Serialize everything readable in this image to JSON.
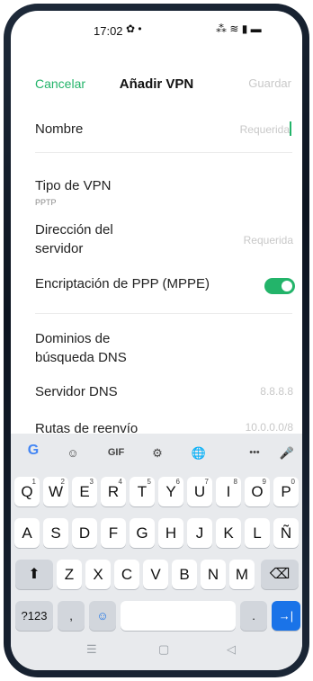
{
  "status_bar": {
    "time": "17:02",
    "left_icons": "✿ •",
    "right_icons": "⁂ ≋ ▮ ▬"
  },
  "header": {
    "cancel": "Cancelar",
    "title": "Añadir VPN",
    "save": "Guardar"
  },
  "form": {
    "name_label": "Nombre",
    "name_placeholder": "Requerida",
    "type_label": "Tipo de VPN",
    "type_value": "PPTP",
    "server_label_1": "Dirección del",
    "server_label_2": "servidor",
    "server_placeholder": "Requerida",
    "mppe_label": "Encriptación de PPP (MPPE)",
    "mppe_enabled": true,
    "dns_domains_label_1": "Dominios de",
    "dns_domains_label_2": "búsqueda DNS",
    "dns_server_label": "Servidor DNS",
    "dns_server_placeholder": "8.8.8.8",
    "routes_label_partial": "Rutas de reenvío",
    "routes_placeholder": "10.0.0.0/8"
  },
  "keyboard": {
    "toolbar": [
      "G",
      "☺",
      "GIF",
      "⚙",
      "🌐",
      "•••",
      "🎤"
    ],
    "row1": [
      "Q",
      "W",
      "E",
      "R",
      "T",
      "Y",
      "U",
      "I",
      "O",
      "P"
    ],
    "row1_numbers": [
      "1",
      "2",
      "3",
      "4",
      "5",
      "6",
      "7",
      "8",
      "9",
      "0"
    ],
    "row2": [
      "A",
      "S",
      "D",
      "F",
      "G",
      "H",
      "J",
      "K",
      "L",
      "Ñ"
    ],
    "row3": [
      "Z",
      "X",
      "C",
      "V",
      "B",
      "N",
      "M"
    ],
    "shift": "⬆",
    "backspace": "⌫",
    "symbols": "?123",
    "comma": ",",
    "emoji": "☺",
    "period": ".",
    "enter": "→|"
  },
  "navbar": {
    "menu": "☰",
    "home": "▢",
    "back": "◁"
  },
  "colors": {
    "accent": "#23b46a",
    "enter_key": "#1a73e8"
  }
}
